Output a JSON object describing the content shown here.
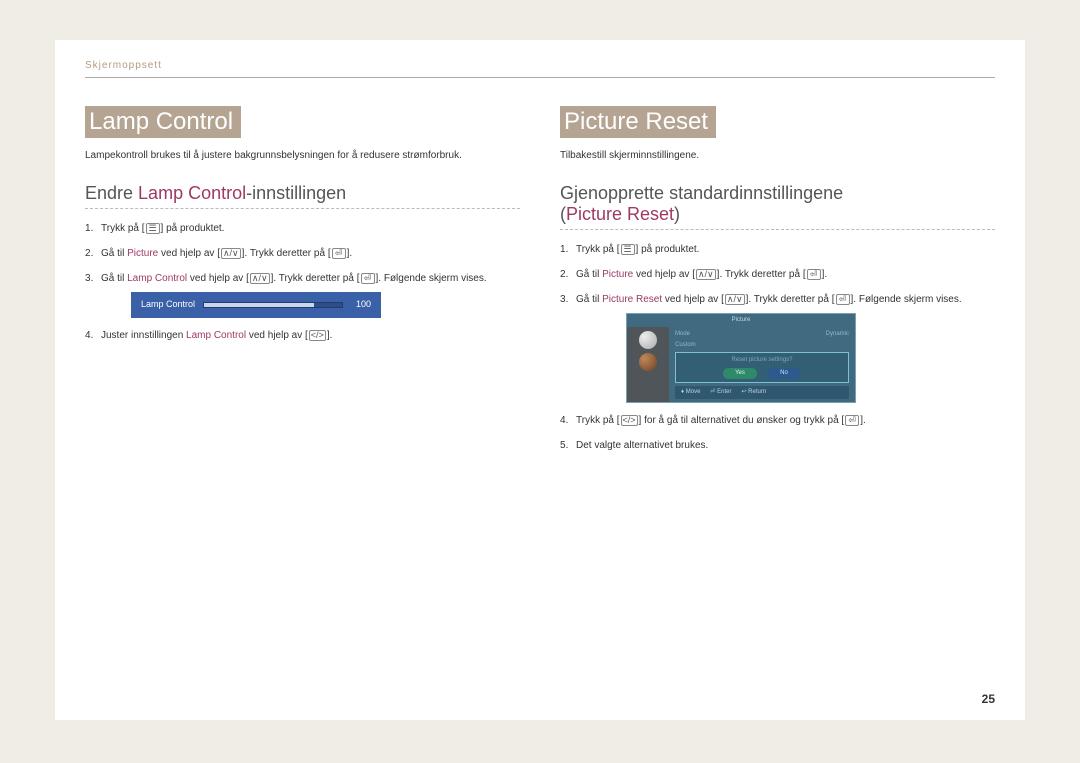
{
  "header": {
    "breadcrumb": "Skjermoppsett"
  },
  "left": {
    "sectionTitle": "Lamp Control",
    "intro": "Lampekontroll brukes til å justere bakgrunnsbelysningen for å redusere strømforbruk.",
    "subheading": {
      "pre": "Endre ",
      "accent": "Lamp Control",
      "post": "-innstillingen"
    },
    "steps": {
      "s1a": "Trykk på ",
      "s1b": " på produktet.",
      "s2a": "Gå til ",
      "s2accent": "Picture",
      "s2b": " ved hjelp av ",
      "s2c": ". Trykk deretter på ",
      "s2d": ".",
      "s3a": "Gå til ",
      "s3accent": "Lamp Control",
      "s3b": " ved hjelp av ",
      "s3c": ". Trykk deretter på ",
      "s3d": ". Følgende skjerm vises.",
      "s4a": "Juster innstillingen ",
      "s4accent": "Lamp Control",
      "s4b": " ved hjelp av ",
      "s4c": "."
    },
    "slider": {
      "label": "Lamp Control",
      "value": "100"
    }
  },
  "right": {
    "sectionTitle": "Picture Reset",
    "intro": "Tilbakestill skjerminnstillingene.",
    "subheading": {
      "line1": "Gjenopprette standardinnstillingene",
      "line2pre": "(",
      "line2accent": "Picture Reset",
      "line2post": ")"
    },
    "steps": {
      "s1a": "Trykk på ",
      "s1b": " på produktet.",
      "s2a": "Gå til ",
      "s2accent": "Picture",
      "s2b": " ved hjelp av ",
      "s2c": ". Trykk deretter på ",
      "s2d": ".",
      "s3a": "Gå til ",
      "s3accent": "Picture Reset",
      "s3b": " ved hjelp av ",
      "s3c": ". Trykk deretter på ",
      "s3d": ". Følgende skjerm vises.",
      "s4a": "Trykk på ",
      "s4b": " for å gå til alternativet du ønsker og trykk på ",
      "s4c": ".",
      "s5": "Det valgte alternativet brukes."
    },
    "fig": {
      "title": "Picture",
      "row1a": "Mode",
      "row1b": "Dynamic",
      "row2": "Custom",
      "dialogMsg": "Reset picture settings?",
      "yes": "Yes",
      "no": "No",
      "foot1": "Move",
      "foot2": "Enter",
      "foot3": "Return"
    }
  },
  "icons": {
    "menu": "☰",
    "updown": "∧/∨",
    "enter": "⏎",
    "leftright": "</>"
  },
  "pageNumber": "25"
}
